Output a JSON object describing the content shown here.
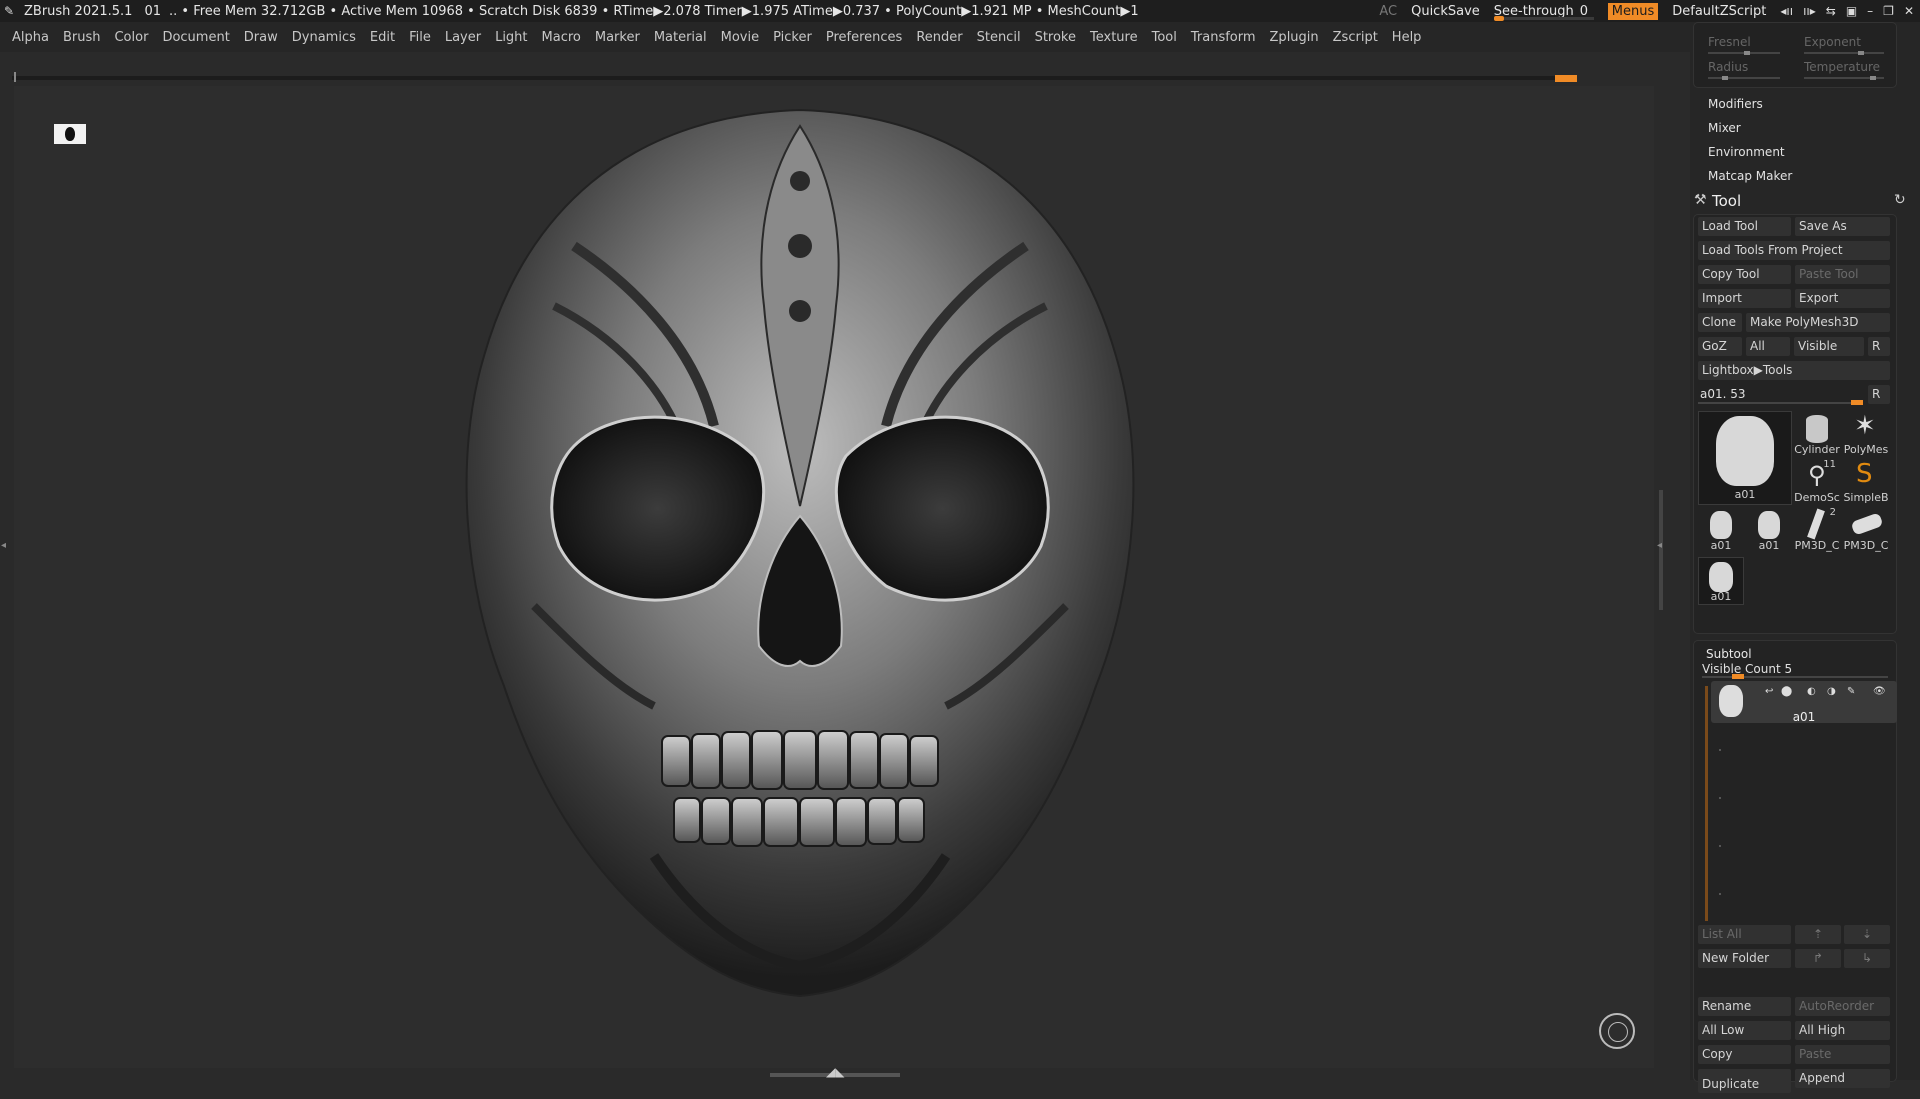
{
  "titlebar": {
    "app": "ZBrush 2021.5.1",
    "doc": "01",
    "status": ".. • Free Mem 32.712GB • Active Mem 10968 • Scratch Disk 6839 •  RTime▶2.078 Timer▶1.975 ATime▶0.737 • PolyCount▶1.921 MP  • MeshCount▶1",
    "ac": "AC",
    "quicksave": "QuickSave",
    "see_through_label": "See-through",
    "see_through_value": "0",
    "see_through_level": 0,
    "menus": "Menus",
    "script": "DefaultZScript"
  },
  "menubar": [
    "Alpha",
    "Brush",
    "Color",
    "Document",
    "Draw",
    "Dynamics",
    "Edit",
    "File",
    "Layer",
    "Light",
    "Macro",
    "Marker",
    "Material",
    "Movie",
    "Picker",
    "Preferences",
    "Render",
    "Stencil",
    "Stroke",
    "Texture",
    "Tool",
    "Transform",
    "Zplugin",
    "Zscript",
    "Help"
  ],
  "material_box": {
    "fresnel": "Fresnel",
    "exponent": "Exponent",
    "radius": "Radius",
    "temperature": "Temperature"
  },
  "panel_items": [
    "Modifiers",
    "Mixer",
    "Environment",
    "Matcap Maker"
  ],
  "tool": {
    "title": "Tool",
    "buttons": {
      "load_tool": "Load Tool",
      "save_as": "Save As",
      "load_from_project": "Load Tools From Project",
      "copy_tool": "Copy Tool",
      "paste_tool": "Paste Tool",
      "import": "Import",
      "export": "Export",
      "clone": "Clone",
      "make_polymesh": "Make PolyMesh3D",
      "goz": "GoZ",
      "all": "All",
      "visible": "Visible",
      "r": "R",
      "lightbox": "Lightbox▶Tools"
    },
    "current_tool": "a01. 53",
    "current_r": "R",
    "thumbs": {
      "main": "a01",
      "cylinder": "Cylinder",
      "polymesh": "PolyMes",
      "demosoldier": "DemoSc",
      "simpleb": "SimpleB",
      "a01_1": "a01",
      "a01_2": "a01",
      "pm3d_1": "PM3D_C",
      "pm3d_2": "PM3D_C",
      "a01_3": "a01",
      "num_11": "11",
      "num_2": "2"
    }
  },
  "subtool": {
    "title": "Subtool",
    "visible_count": "Visible Count 5",
    "item_name": "a01",
    "list_all": "List All",
    "new_folder": "New Folder",
    "rename": "Rename",
    "autoreorder": "AutoReorder",
    "all_low": "All Low",
    "all_high": "All High",
    "copy": "Copy",
    "paste": "Paste",
    "duplicate": "Duplicate",
    "append": "Append"
  },
  "colors": {
    "accent": "#f08b26"
  }
}
